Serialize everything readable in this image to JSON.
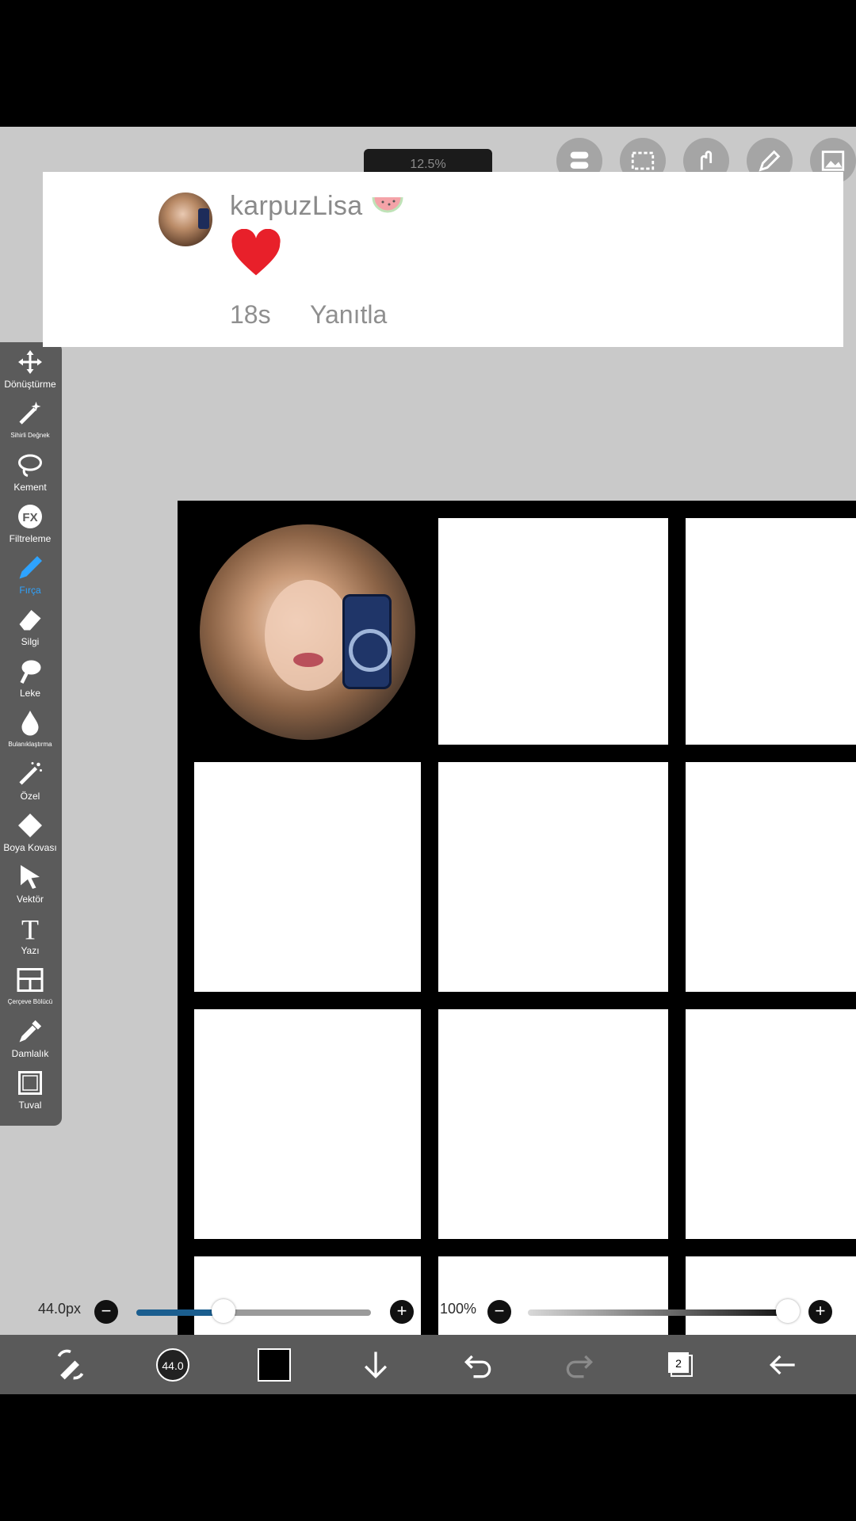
{
  "comment": {
    "username": "karpuzLisa",
    "time": "18s",
    "reply_label": "Yanıtla",
    "emoji_icon": "watermelon-icon",
    "reaction_icon": "heart-icon",
    "heart_color": "#e8202a"
  },
  "toolbar": {
    "zoom_text": "12.5%"
  },
  "tools": [
    {
      "label": "Dönüştürme",
      "icon": "move-icon"
    },
    {
      "label": "Sihirli Değnek",
      "icon": "magic-wand-icon"
    },
    {
      "label": "Kement",
      "icon": "lasso-icon"
    },
    {
      "label": "Filtreleme",
      "icon": "fx-icon"
    },
    {
      "label": "Fırça",
      "icon": "brush-icon",
      "active": true
    },
    {
      "label": "Silgi",
      "icon": "eraser-icon"
    },
    {
      "label": "Leke",
      "icon": "smudge-icon"
    },
    {
      "label": "Bulanıklaştırma",
      "icon": "blur-icon"
    },
    {
      "label": "Özel",
      "icon": "special-icon"
    },
    {
      "label": "Boya Kovası",
      "icon": "paint-bucket-icon"
    },
    {
      "label": "Vektör",
      "icon": "vector-icon"
    },
    {
      "label": "Yazı",
      "icon": "text-icon"
    },
    {
      "label": "Çerçeve Bölücü",
      "icon": "frame-divider-icon"
    },
    {
      "label": "Damlalık",
      "icon": "eyedropper-icon"
    },
    {
      "label": "Tuval",
      "icon": "canvas-icon"
    }
  ],
  "brush": {
    "size_label": "44.0px",
    "size_fraction": 0.37,
    "opacity_label": "100%",
    "opacity_fraction": 1.0,
    "size_badge": "44.0"
  },
  "layers_count": "2",
  "accent_color": "#2ea3ff"
}
